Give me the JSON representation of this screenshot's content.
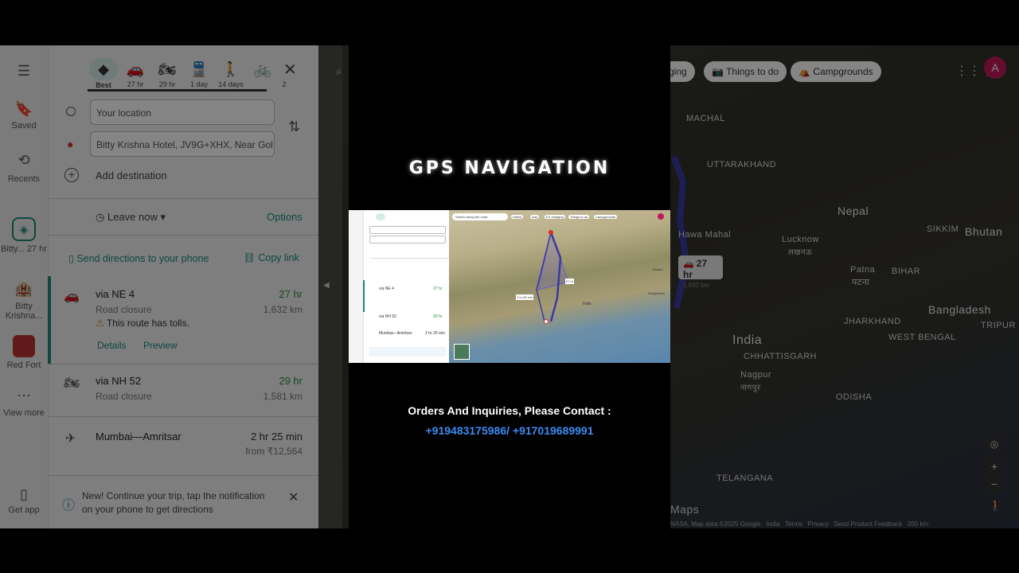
{
  "background_panel": {
    "modes": [
      {
        "icon": "best-route-icon",
        "label": "Best"
      },
      {
        "icon": "car-icon",
        "label": "27 hr"
      },
      {
        "icon": "motorcycle-icon",
        "label": "29 hr"
      },
      {
        "icon": "train-icon",
        "label": "1 day"
      },
      {
        "icon": "walk-icon",
        "label": "14 days"
      },
      {
        "icon": "bicycle-icon",
        "label": "2"
      }
    ],
    "origin_value": "Your location",
    "destination_value": "Bitty Krishna Hotel, JV9G+XHX, Near Gol",
    "add_destination": "Add destination",
    "leave_now": "Leave now",
    "options": "Options",
    "send_directions": "Send directions to your phone",
    "copy_link": "Copy link",
    "routes": [
      {
        "title": "via NE 4",
        "sub": "Road closure",
        "time": "27 hr",
        "dist": "1,632 km",
        "warning": "This route has tolls.",
        "details": "Details",
        "preview": "Preview"
      },
      {
        "title": "via NH 52",
        "sub": "Road closure",
        "time": "29 hr",
        "dist": "1,581 km"
      },
      {
        "title": "Mumbai—Amritsar",
        "time": "2 hr 25 min",
        "dist": "from ₹12,564"
      }
    ],
    "notice": "New! Continue your trip, tap the notification on your phone to get directions",
    "rail": [
      {
        "label": "Saved"
      },
      {
        "label": "Recents"
      },
      {
        "label": "Bitty... 27 hr"
      },
      {
        "label": "Bitty Krishna..."
      },
      {
        "label": "Red Fort"
      },
      {
        "label": "View more"
      },
      {
        "label": "Get app"
      }
    ]
  },
  "background_map": {
    "chips": [
      "Things to do",
      "Campgrounds"
    ],
    "chip_partial": "ging",
    "avatar": "A",
    "labels": [
      "UTTARAKHAND",
      "Nepal",
      "Bhutan",
      "Hawa Mahal",
      "Lucknow",
      "लखनऊ",
      "SIKKIM",
      "Patna",
      "पटना",
      "BIHAR",
      "Bangladesh",
      "JHARKHAND",
      "TRIPUR",
      "WEST BENGAL",
      "India",
      "CHHATTISGARH",
      "Nagpur",
      "नागपुर",
      "ODISHA",
      "TELANGANA",
      "MACHAL",
      "NASA, Map data ©2025 Google",
      "India",
      "Terms",
      "Privacy",
      "Send Product Feedback",
      "200 km",
      "Maps",
      "27 hr",
      "1,632 km"
    ]
  },
  "card": {
    "title": "GPS NAVIGATION",
    "contact": "Orders And Inquiries, Please Contact :",
    "phones": "+919483175986/ +917019689991"
  },
  "mini_screenshot": {
    "chips": [
      "Hotels",
      "Gas",
      "EV charging",
      "Things to do",
      "Campgrounds"
    ],
    "search": "Search along the route",
    "routes": [
      {
        "title": "via NE 4",
        "time": "27 hr"
      },
      {
        "title": "via NH 52",
        "time": "29 hr"
      },
      {
        "title": "Mumbai—Amritsar",
        "time": "2 hr 25 min"
      }
    ],
    "map_labels": [
      "India",
      "Bhutan",
      "Bangladesh",
      "27 hr",
      "1 hr 25 min"
    ]
  },
  "colors": {
    "accent": "#1a8a7a",
    "link_blue": "#3d8cf5",
    "route_purple": "#6a5acd",
    "pin_red": "#d93025"
  }
}
